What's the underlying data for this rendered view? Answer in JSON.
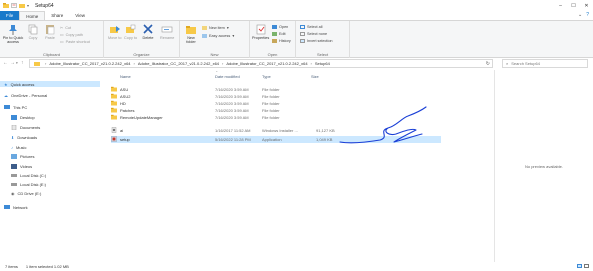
{
  "window": {
    "title": "Setup64"
  },
  "tabs": [
    {
      "label": "File"
    },
    {
      "label": "Home"
    },
    {
      "label": "Share"
    },
    {
      "label": "View"
    }
  ],
  "ribbon": {
    "clipboard": {
      "label": "Clipboard",
      "pin": "Pin to Quick access",
      "copy": "Copy",
      "paste": "Paste",
      "cut": "Cut",
      "copy_path": "Copy path",
      "paste_shortcut": "Paste shortcut"
    },
    "organize": {
      "label": "Organize",
      "move_to": "Move to",
      "copy_to": "Copy to",
      "delete": "Delete",
      "rename": "Rename"
    },
    "new": {
      "label": "New",
      "new_folder": "New folder",
      "new_item": "New item",
      "easy_access": "Easy access"
    },
    "open": {
      "label": "Open",
      "properties": "Properties",
      "open": "Open",
      "edit": "Edit",
      "history": "History"
    },
    "select": {
      "label": "Select",
      "select_all": "Select all",
      "select_none": "Select none",
      "invert": "Invert selection"
    }
  },
  "address": {
    "crumbs": [
      "Adobe_Illustrator_CC_2017_v21.0.2.242_x64",
      "Adobe_Illustrator_CC_2017_v21.0.2.242_x64",
      "Adobe_Illustrator_CC_2017_v21.0.2.242_x64",
      "Setup64"
    ],
    "search_placeholder": "Search Setup64"
  },
  "nav": {
    "quick_access": "Quick access",
    "onedrive": "OneDrive - Personal",
    "this_pc": "This PC",
    "desktop": "Desktop",
    "documents": "Documents",
    "downloads": "Downloads",
    "music": "Music",
    "pictures": "Pictures",
    "videos": "Videos",
    "local_c": "Local Disk (C:)",
    "local_e": "Local Disk (E:)",
    "cd_drive": "CD Drive (E:)",
    "network": "Network"
  },
  "columns": {
    "name": "Name",
    "date": "Date modified",
    "type": "Type",
    "size": "Size"
  },
  "files": [
    {
      "name": "ASU",
      "date": "7/16/2020 3:59 AM",
      "type": "File folder",
      "size": "",
      "kind": "folder"
    },
    {
      "name": "ASU2",
      "date": "7/16/2020 3:59 AM",
      "type": "File folder",
      "size": "",
      "kind": "folder"
    },
    {
      "name": "HD",
      "date": "7/16/2020 3:59 AM",
      "type": "File folder",
      "size": "",
      "kind": "folder"
    },
    {
      "name": "Patches",
      "date": "7/16/2020 3:59 AM",
      "type": "File folder",
      "size": "",
      "kind": "folder"
    },
    {
      "name": "RemoteUpdateManager",
      "date": "7/16/2020 3:59 AM",
      "type": "File folder",
      "size": "",
      "kind": "folder"
    },
    {
      "name": "ai",
      "date": "1/16/2017 11:52 AM",
      "type": "Windows Installer ...",
      "size": "91,127 KB",
      "kind": "msi"
    },
    {
      "name": "setup",
      "date": "5/16/2022 11:28 PM",
      "type": "Application",
      "size": "1,049 KB",
      "kind": "app"
    }
  ],
  "preview": {
    "text": "No preview available."
  },
  "status": {
    "count": "7 items",
    "selection": "1 item selected  1.02 MB"
  },
  "colors": {
    "accent": "#1979ca",
    "selection": "#cce8ff",
    "folder": "#f7c948",
    "scribble": "#1a3fd6"
  }
}
